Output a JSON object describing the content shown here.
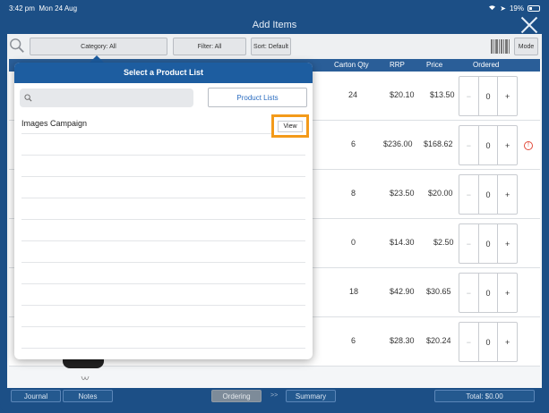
{
  "status": {
    "time": "3:42 pm",
    "date": "Mon 24 Aug",
    "battery": "19%"
  },
  "title": "Add Items",
  "toolbar": {
    "category": "Category: All",
    "filter": "Filter: All",
    "sort": "Sort: Default",
    "mode": "Mode"
  },
  "columns": {
    "carton_qty": "Carton Qty",
    "rrp": "RRP",
    "price": "Price",
    "ordered": "Ordered"
  },
  "rows": [
    {
      "carton_qty": "24",
      "rrp": "$20.10",
      "price": "$13.50",
      "ordered": "0",
      "warning": false
    },
    {
      "carton_qty": "6",
      "rrp": "$236.00",
      "price": "$168.62",
      "ordered": "0",
      "warning": true
    },
    {
      "carton_qty": "8",
      "rrp": "$23.50",
      "price": "$20.00",
      "ordered": "0",
      "warning": false
    },
    {
      "carton_qty": "0",
      "rrp": "$14.30",
      "price": "$2.50",
      "ordered": "0",
      "warning": false
    },
    {
      "carton_qty": "18",
      "rrp": "$42.90",
      "price": "$30.65",
      "ordered": "0",
      "warning": false
    },
    {
      "carton_qty": "6",
      "rrp": "$28.30",
      "price": "$20.24",
      "ordered": "0",
      "warning": false
    }
  ],
  "stepper": {
    "minus": "−",
    "plus": "+"
  },
  "warning_glyph": "!",
  "popover": {
    "title": "Select a Product List",
    "search_placeholder": "",
    "product_lists_label": "Product Lists",
    "items": [
      "Images Campaign"
    ],
    "view_label": "View"
  },
  "bottom": {
    "journal": "Journal",
    "notes": "Notes",
    "ordering": "Ordering",
    "arrows": ">>",
    "summary": "Summary",
    "total": "Total: $0.00"
  },
  "colors": {
    "accent": "#1d5da0",
    "highlight": "#f39a1a",
    "link": "#2a6cc0",
    "warning": "#e24b3b"
  }
}
